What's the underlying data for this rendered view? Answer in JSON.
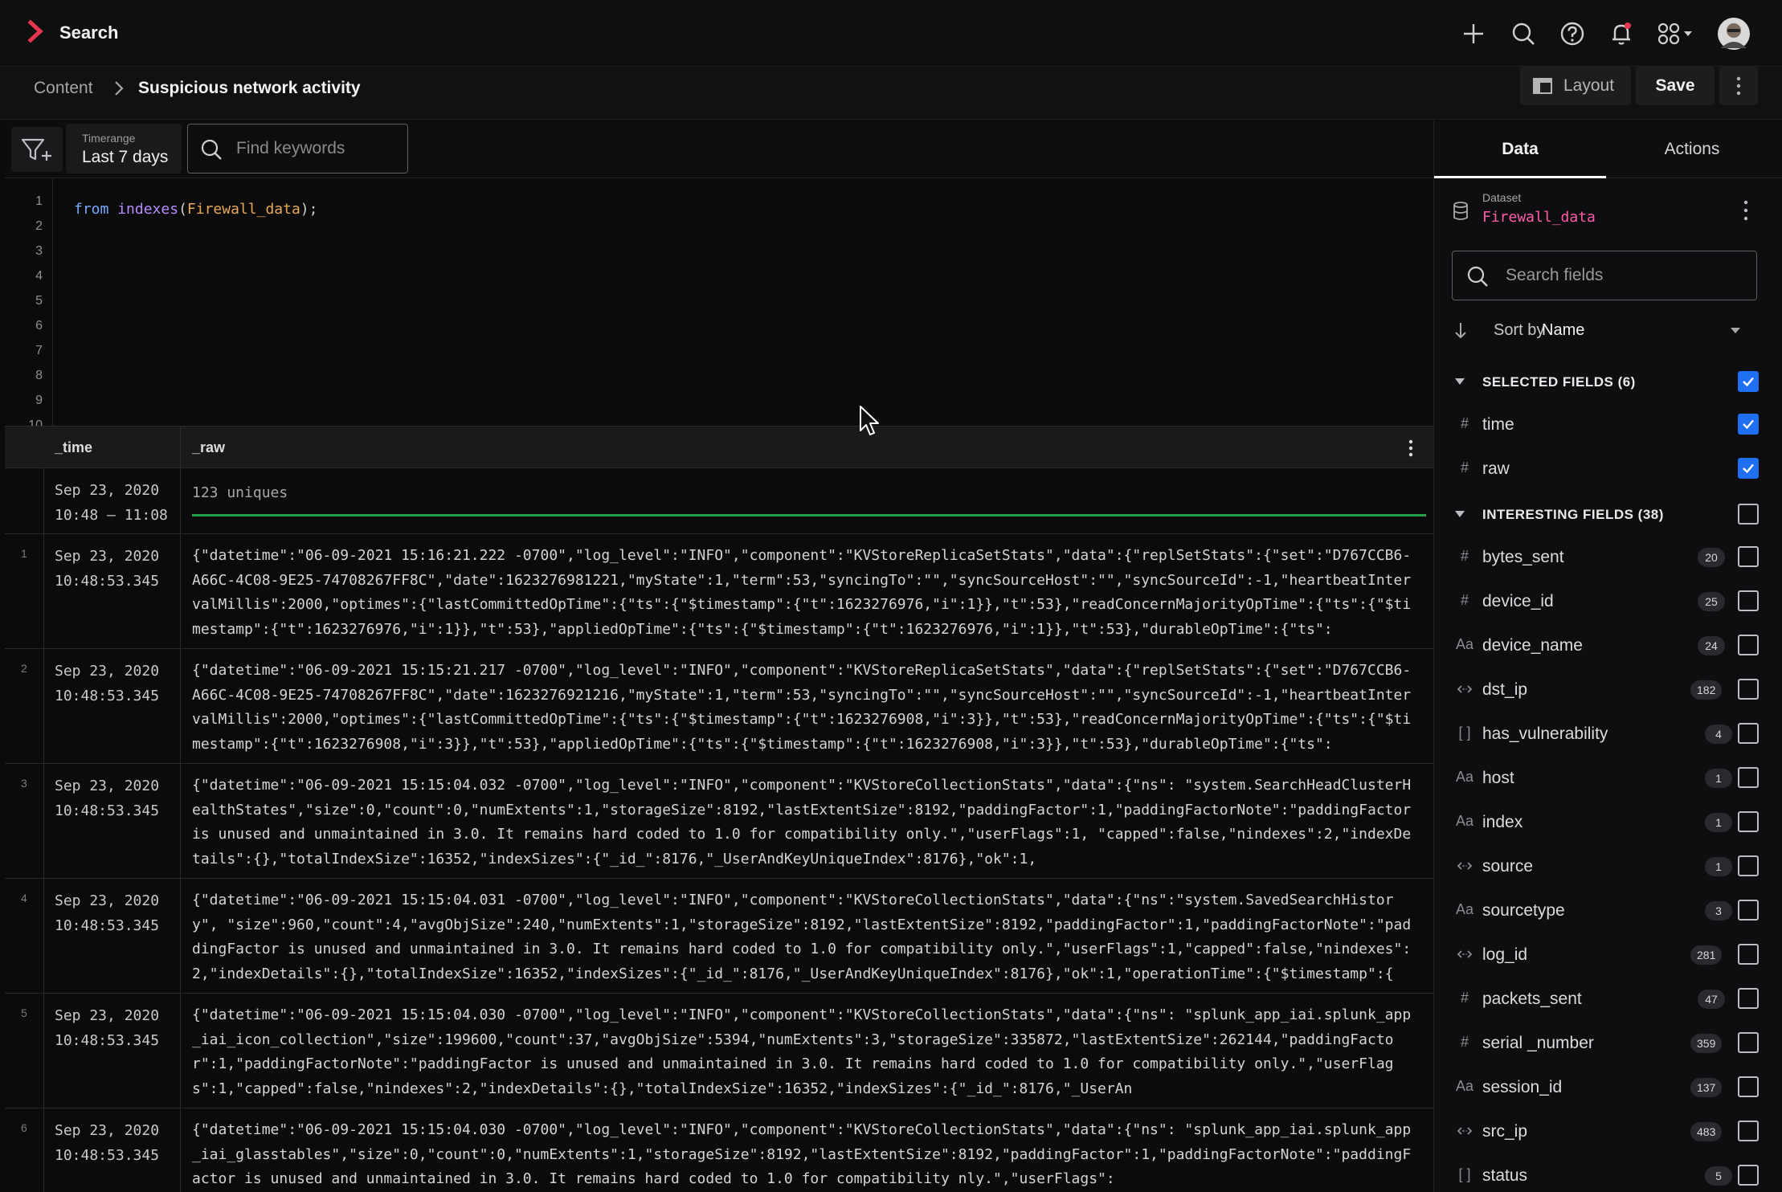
{
  "app": {
    "title": "Search",
    "brand_color": "#e8364f"
  },
  "topbar_icons": [
    "plus-icon",
    "search-icon",
    "help-icon",
    "bell-icon",
    "apps-grid-icon",
    "user-avatar"
  ],
  "breadcrumb": {
    "root": "Content",
    "current": "Suspicious network activity"
  },
  "actions": {
    "layout_label": "Layout",
    "save_label": "Save"
  },
  "filter": {
    "timerange_label": "Timerange",
    "timerange_value": "Last 7 days",
    "search_placeholder": "Find keywords"
  },
  "editor": {
    "line_numbers": [
      "1",
      "2",
      "3",
      "4",
      "5",
      "6",
      "7",
      "8",
      "9",
      "10"
    ],
    "code": {
      "keyword": "from",
      "function": "indexes",
      "open": "(",
      "argument": "Firewall_data",
      "close": ");"
    }
  },
  "table": {
    "columns": [
      "_time",
      "_raw"
    ],
    "summary": {
      "time": "Sep 23, 2020\n10:48 – 11:08",
      "raw": "123 uniques"
    },
    "rows": [
      {
        "num": "1",
        "time": "Sep 23, 2020\n10:48:53.345",
        "raw": "{\"datetime\":\"06-09-2021 15:16:21.222 -0700\",\"log_level\":\"INFO\",\"component\":\"KVStoreReplicaSetStats\",\"data\":{\"replSetStats\":{\"set\":\"D767CCB6-A66C-4C08-9E25-74708267FF8C\",\"date\":1623276981221,\"myState\":1,\"term\":53,\"syncingTo\":\"\",\"syncSourceHost\":\"\",\"syncSourceId\":-1,\"heartbeatIntervalMillis\":2000,\"optimes\":{\"lastCommittedOpTime\":{\"ts\":{\"$timestamp\":{\"t\":1623276976,\"i\":1}},\"t\":53},\"readConcernMajorityOpTime\":{\"ts\":{\"$timestamp\":{\"t\":1623276976,\"i\":1}},\"t\":53},\"appliedOpTime\":{\"ts\":{\"$timestamp\":{\"t\":1623276976,\"i\":1}},\"t\":53},\"durableOpTime\":{\"ts\":"
      },
      {
        "num": "2",
        "time": "Sep 23, 2020\n10:48:53.345",
        "raw": "{\"datetime\":\"06-09-2021 15:15:21.217 -0700\",\"log_level\":\"INFO\",\"component\":\"KVStoreReplicaSetStats\",\"data\":{\"replSetStats\":{\"set\":\"D767CCB6-A66C-4C08-9E25-74708267FF8C\",\"date\":1623276921216,\"myState\":1,\"term\":53,\"syncingTo\":\"\",\"syncSourceHost\":\"\",\"syncSourceId\":-1,\"heartbeatIntervalMillis\":2000,\"optimes\":{\"lastCommittedOpTime\":{\"ts\":{\"$timestamp\":{\"t\":1623276908,\"i\":3}},\"t\":53},\"readConcernMajorityOpTime\":{\"ts\":{\"$timestamp\":{\"t\":1623276908,\"i\":3}},\"t\":53},\"appliedOpTime\":{\"ts\":{\"$timestamp\":{\"t\":1623276908,\"i\":3}},\"t\":53},\"durableOpTime\":{\"ts\":"
      },
      {
        "num": "3",
        "time": "Sep 23, 2020\n10:48:53.345",
        "raw": "{\"datetime\":\"06-09-2021 15:15:04.032 -0700\",\"log_level\":\"INFO\",\"component\":\"KVStoreCollectionStats\",\"data\":{\"ns\": \"system.SearchHeadClusterHealthStates\",\"size\":0,\"count\":0,\"numExtents\":1,\"storageSize\":8192,\"lastExtentSize\":8192,\"paddingFactor\":1,\"paddingFactorNote\":\"paddingFactor is unused and unmaintained in 3.0. It remains hard coded to 1.0 for compatibility only.\",\"userFlags\":1, \"capped\":false,\"nindexes\":2,\"indexDetails\":{},\"totalIndexSize\":16352,\"indexSizes\":{\"_id_\":8176,\"_UserAndKeyUniqueIndex\":8176},\"ok\":1,"
      },
      {
        "num": "4",
        "time": "Sep 23, 2020\n10:48:53.345",
        "raw": "{\"datetime\":\"06-09-2021 15:15:04.031 -0700\",\"log_level\":\"INFO\",\"component\":\"KVStoreCollectionStats\",\"data\":{\"ns\":\"system.SavedSearchHistory\", \"size\":960,\"count\":4,\"avgObjSize\":240,\"numExtents\":1,\"storageSize\":8192,\"lastExtentSize\":8192,\"paddingFactor\":1,\"paddingFactorNote\":\"paddingFactor is unused and unmaintained in 3.0. It remains hard coded to 1.0 for compatibility only.\",\"userFlags\":1,\"capped\":false,\"nindexes\": 2,\"indexDetails\":{},\"totalIndexSize\":16352,\"indexSizes\":{\"_id_\":8176,\"_UserAndKeyUniqueIndex\":8176},\"ok\":1,\"operationTime\":{\"$timestamp\":{"
      },
      {
        "num": "5",
        "time": "Sep 23, 2020\n10:48:53.345",
        "raw": "{\"datetime\":\"06-09-2021 15:15:04.030 -0700\",\"log_level\":\"INFO\",\"component\":\"KVStoreCollectionStats\",\"data\":{\"ns\": \"splunk_app_iai.splunk_app_iai_icon_collection\",\"size\":199600,\"count\":37,\"avgObjSize\":5394,\"numExtents\":3,\"storageSize\":335872,\"lastExtentSize\":262144,\"paddingFactor\":1,\"paddingFactorNote\":\"paddingFactor is unused and unmaintained in 3.0. It remains hard coded to 1.0 for compatibility only.\",\"userFlags\":1,\"capped\":false,\"nindexes\":2,\"indexDetails\":{},\"totalIndexSize\":16352,\"indexSizes\":{\"_id_\":8176,\"_UserAn"
      },
      {
        "num": "6",
        "time": "Sep 23, 2020\n10:48:53.345",
        "raw": "{\"datetime\":\"06-09-2021 15:15:04.030 -0700\",\"log_level\":\"INFO\",\"component\":\"KVStoreCollectionStats\",\"data\":{\"ns\": \"splunk_app_iai.splunk_app_iai_glasstables\",\"size\":0,\"count\":0,\"numExtents\":1,\"storageSize\":8192,\"lastExtentSize\":8192,\"paddingFactor\":1,\"paddingFactorNote\":\"paddingFactor is unused and unmaintained in 3.0. It remains hard coded to 1.0 for compatibility nly.\",\"userFlags\":"
      }
    ]
  },
  "panel": {
    "tabs": [
      "Data",
      "Actions"
    ],
    "dataset_label": "Dataset",
    "dataset_name": "Firewall_data",
    "search_placeholder": "Search fields",
    "sort_label": "Sort by",
    "sort_value": "Name",
    "selected_header": "SELECTED FIELDS (6)",
    "selected_checked": true,
    "selected_fields": [
      {
        "type": "number",
        "name": "time",
        "checked": true
      },
      {
        "type": "number",
        "name": "raw",
        "checked": true
      }
    ],
    "interesting_header": "INTERESTING FIELDS (38)",
    "interesting_checked": false,
    "interesting_fields": [
      {
        "type": "number",
        "name": "bytes_sent",
        "count": "20",
        "checked": false
      },
      {
        "type": "number",
        "name": "device_id",
        "count": "25",
        "checked": false
      },
      {
        "type": "string",
        "name": "device_name",
        "count": "24",
        "checked": false
      },
      {
        "type": "ip",
        "name": "dst_ip",
        "count": "182",
        "checked": false
      },
      {
        "type": "array",
        "name": "has_vulnerability",
        "count": "4",
        "checked": false
      },
      {
        "type": "string",
        "name": "host",
        "count": "1",
        "checked": false
      },
      {
        "type": "string",
        "name": "index",
        "count": "1",
        "checked": false
      },
      {
        "type": "ip",
        "name": "source",
        "count": "1",
        "checked": false
      },
      {
        "type": "string",
        "name": "sourcetype",
        "count": "3",
        "checked": false
      },
      {
        "type": "ip",
        "name": "log_id",
        "count": "281",
        "checked": false
      },
      {
        "type": "number",
        "name": "packets_sent",
        "count": "47",
        "checked": false
      },
      {
        "type": "number",
        "name": "serial _number",
        "count": "359",
        "checked": false
      },
      {
        "type": "string",
        "name": "session_id",
        "count": "137",
        "checked": false
      },
      {
        "type": "ip",
        "name": "src_ip",
        "count": "483",
        "checked": false
      },
      {
        "type": "array",
        "name": "status",
        "count": "5",
        "checked": false
      }
    ],
    "type_glyphs": {
      "number": "#",
      "string": "Aa",
      "array": "[ ]"
    }
  }
}
